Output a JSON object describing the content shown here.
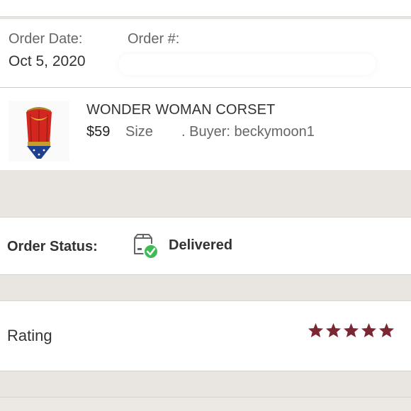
{
  "order": {
    "date_label": "Order Date:",
    "date_value": "Oct 5, 2020",
    "number_label": "Order #:"
  },
  "item": {
    "title": "WONDER WOMAN CORSET",
    "price": "$59",
    "size_label": "Size",
    "buyer": ". Buyer: beckymoon1",
    "image": "wonder-woman-corset-thumbnail"
  },
  "status": {
    "label": "Order Status:",
    "value": "Delivered",
    "icon": "package-delivered-icon"
  },
  "rating": {
    "label": "Rating",
    "stars": 5,
    "star_color": "#7b2633"
  },
  "colors": {
    "page_bg": "#e9e6e2",
    "panel_bg": "#ffffff",
    "check_green": "#3dbb55"
  }
}
